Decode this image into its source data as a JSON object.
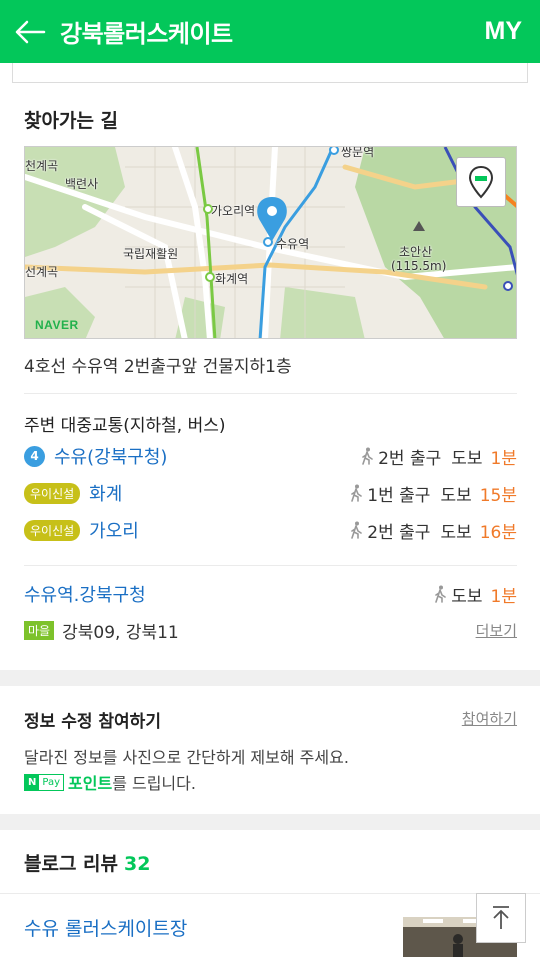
{
  "header": {
    "title": "강북롤러스케이트",
    "my_label": "MY",
    "bg_color": "#03c75a"
  },
  "directions": {
    "title": "찾아가는 길",
    "map": {
      "labels": {
        "cheongyesa": "천계곡",
        "baengnyeonsa": "백련사",
        "gaori_station": "가오리역",
        "rehab": "국립재활원",
        "suyu_station": "수유역",
        "hwagye_station": "화계역",
        "cheongyegok": "선계곡",
        "choansan": "초안산",
        "choansan_height": "(115.5m)",
        "ssangmun": "쌍문역"
      },
      "naver_logo": "NAVER",
      "location_button_icon": "location-pin-icon"
    },
    "address": "4호선 수유역 2번출구앞 건물지하1층"
  },
  "transit": {
    "title": "주변 대중교통(지하철, 버스)",
    "subway": [
      {
        "badge": "4",
        "name": "수유(강북구청)",
        "exit": "2번 출구",
        "walk": "도보",
        "time": "1분"
      },
      {
        "badge": "우이신설",
        "name": "화계",
        "exit": "1번 출구",
        "walk": "도보",
        "time": "15분"
      },
      {
        "badge": "우이신설",
        "name": "가오리",
        "exit": "2번 출구",
        "walk": "도보",
        "time": "16분"
      }
    ],
    "bus_stop": {
      "name": "수유역.강북구청",
      "walk": "도보",
      "time": "1분"
    },
    "bus": {
      "badge": "마을",
      "routes": "강북09,  강북11",
      "more": "더보기"
    }
  },
  "info_edit": {
    "title": "정보 수정 참여하기",
    "link": "참여하기",
    "desc": "달라진 정보를 사진으로 간단하게 제보해 주세요.",
    "npay_n": "N",
    "npay_pay": "Pay",
    "point": "포인트",
    "point_suffix": "를 드립니다."
  },
  "blog": {
    "title": "블로그 리뷰",
    "count": "32",
    "first_item": "수유 롤러스케이트장"
  }
}
